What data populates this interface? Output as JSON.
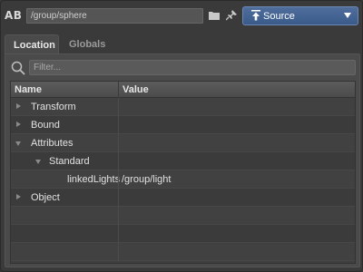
{
  "header": {
    "logo_text": "AB",
    "location_path": "/group/sphere",
    "folder_icon": "folder-icon",
    "pin_icon": "pin-icon",
    "source_label": "Source",
    "source_icon": "upload-arrow-icon",
    "accent_color": "#3f5f8f"
  },
  "tabs": [
    {
      "label": "Location",
      "active": true
    },
    {
      "label": "Globals",
      "active": false
    }
  ],
  "filter": {
    "placeholder": "Filter...",
    "value": "",
    "icon": "search-icon"
  },
  "table": {
    "columns": [
      "Name",
      "Value"
    ],
    "rows": [
      {
        "name": "Transform",
        "value": "",
        "expander": "collapsed"
      },
      {
        "name": "Bound",
        "value": "",
        "expander": "collapsed"
      },
      {
        "name": "Attributes",
        "value": "",
        "expander": "expanded"
      },
      {
        "name": "Standard",
        "value": "",
        "expander": "expanded"
      },
      {
        "name": "linkedLights",
        "value": "/group/light",
        "expander": "none"
      },
      {
        "name": "Object",
        "value": "",
        "expander": "collapsed"
      },
      {
        "name": "",
        "value": "",
        "expander": "none"
      },
      {
        "name": "",
        "value": "",
        "expander": "none"
      },
      {
        "name": "",
        "value": "",
        "expander": "none"
      }
    ]
  }
}
